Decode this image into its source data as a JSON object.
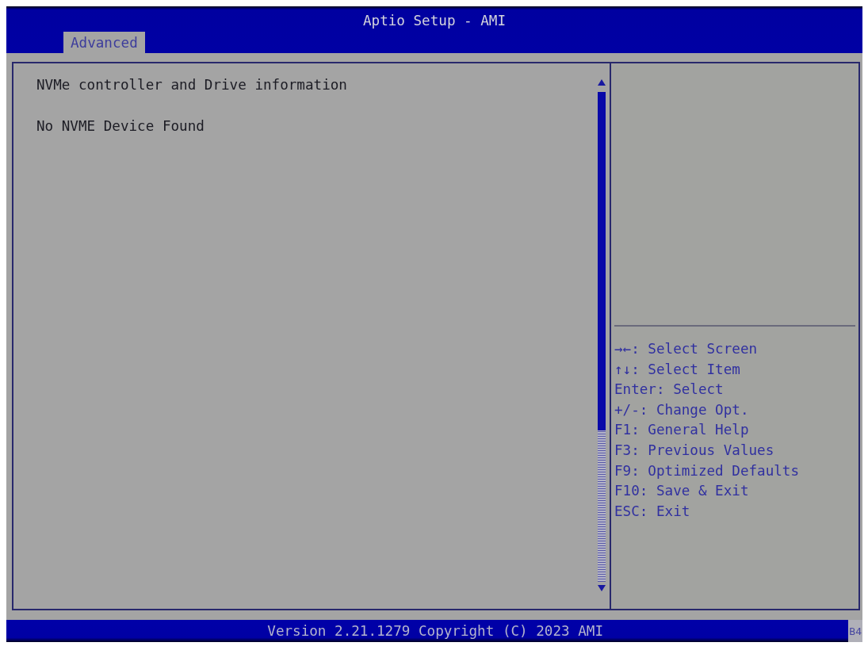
{
  "window": {
    "title": "Aptio Setup - AMI"
  },
  "tabs": [
    {
      "label": "Advanced",
      "selected": true
    }
  ],
  "main_panel": {
    "lines": [
      "NVMe controller and Drive information",
      "No NVME Device Found"
    ]
  },
  "help_panel": {
    "keys": [
      "→←: Select Screen",
      "↑↓: Select Item",
      "Enter: Select",
      "+/-: Change Opt.",
      "F1: General Help",
      "F3: Previous Values",
      "F9: Optimized Defaults",
      "F10: Save & Exit",
      "ESC: Exit"
    ]
  },
  "status_bar": {
    "text": "Version 2.21.1279 Copyright (C) 2023 AMI",
    "code": "B4"
  }
}
